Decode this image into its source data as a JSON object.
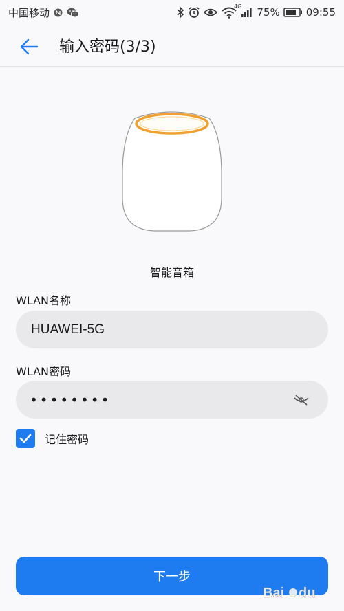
{
  "status_bar": {
    "carrier": "中国移动",
    "network_badge": "4G",
    "battery": "75%",
    "time": "09:55",
    "icons": [
      "nfc-icon",
      "wechat-icon",
      "bluetooth-icon",
      "alarm-icon",
      "eye-comfort-icon",
      "wifi-icon",
      "signal-icon",
      "battery-icon"
    ]
  },
  "header": {
    "title": "输入密码(3/3)",
    "back_icon": "arrow-left-icon"
  },
  "device": {
    "name": "智能音箱",
    "accent_color": "#f0a030"
  },
  "form": {
    "ssid_label": "WLAN名称",
    "ssid_value": "HUAWEI-5G",
    "password_label": "WLAN密码",
    "password_value": "••••••••",
    "password_toggle_icon": "eye-hidden-icon",
    "remember_label": "记住密码",
    "remember_checked": true
  },
  "actions": {
    "next_label": "下一步"
  },
  "colors": {
    "accent": "#1e7cf0",
    "field_bg": "#e9e9ec",
    "page_bg": "#f9f9fb"
  }
}
